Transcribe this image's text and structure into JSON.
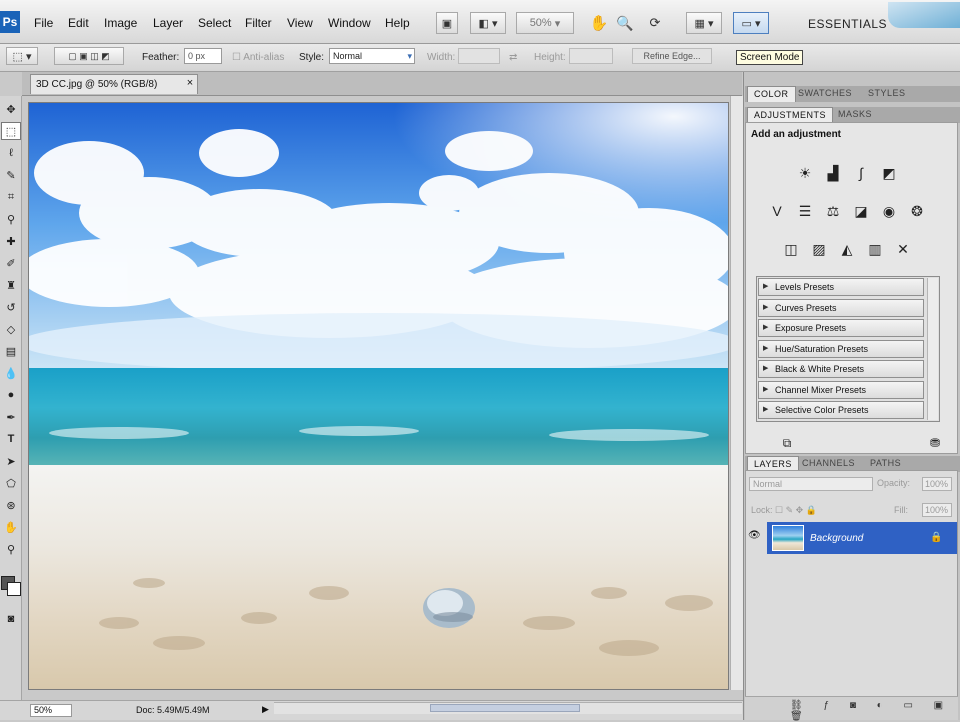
{
  "app": {
    "logo": "Ps",
    "menus": [
      "File",
      "Edit",
      "Image",
      "Layer",
      "Select",
      "Filter",
      "View",
      "Window",
      "Help"
    ],
    "zoom": "50%",
    "workspace": "ESSENTIALS",
    "tooltip": "Screen Mode"
  },
  "options": {
    "feather_label": "Feather:",
    "feather_value": "0 px",
    "antialias_label": "Anti-alias",
    "style_label": "Style:",
    "style_value": "Normal",
    "width_label": "Width:",
    "height_label": "Height:",
    "refine_edge": "Refine Edge..."
  },
  "document": {
    "tab_title": "3D CC.jpg @ 50% (RGB/8)",
    "close": "×"
  },
  "status": {
    "zoom": "50%",
    "doc_size": "Doc: 5.49M/5.49M"
  },
  "panels": {
    "top_tabs": [
      "COLOR",
      "SWATCHES",
      "STYLES"
    ],
    "adj_tabs": [
      "ADJUSTMENTS",
      "MASKS"
    ],
    "adj_title": "Add an adjustment",
    "presets": [
      "Levels Presets",
      "Curves Presets",
      "Exposure Presets",
      "Hue/Saturation Presets",
      "Black & White Presets",
      "Channel Mixer Presets",
      "Selective Color Presets"
    ],
    "layer_tabs": [
      "LAYERS",
      "CHANNELS",
      "PATHS"
    ],
    "blend_mode": "Normal",
    "opacity_label": "Opacity:",
    "opacity_value": "100%",
    "lock_label": "Lock:",
    "fill_label": "Fill:",
    "fill_value": "100%",
    "layers": [
      {
        "name": "Background",
        "selected": true
      }
    ]
  }
}
